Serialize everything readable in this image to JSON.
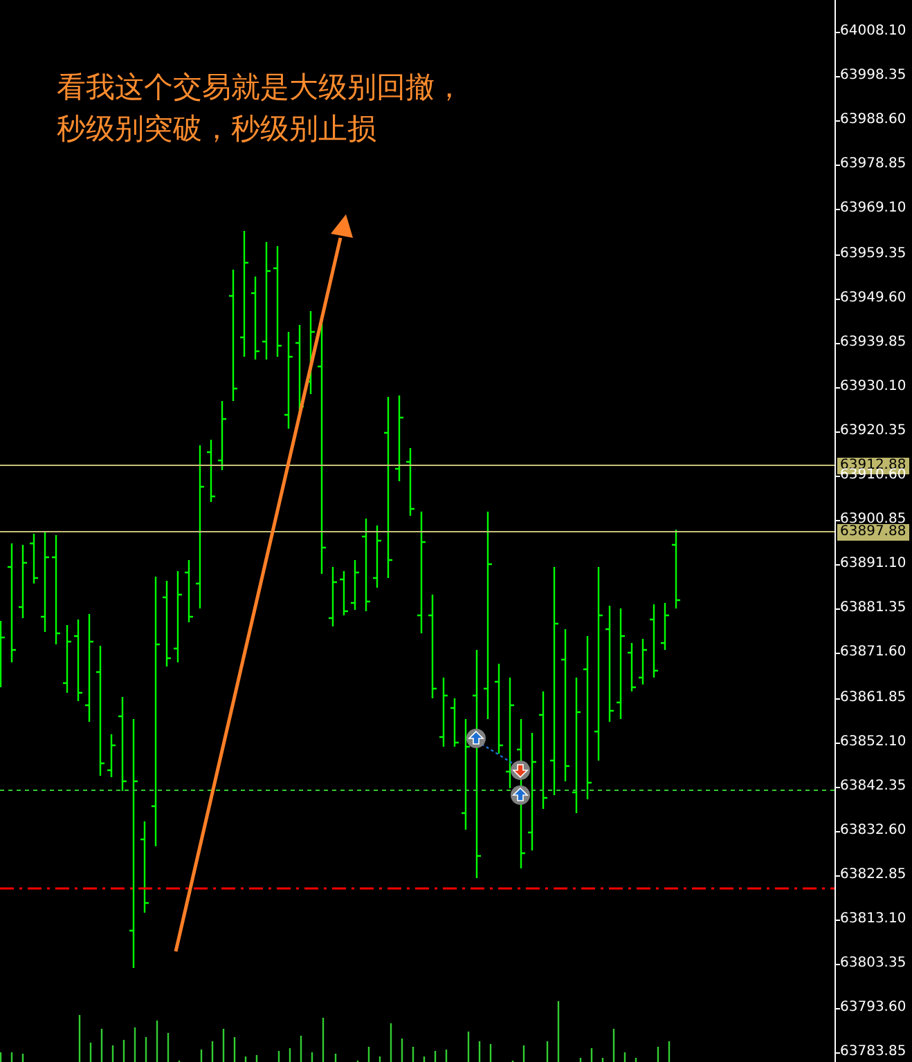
{
  "annotation": {
    "lines": [
      "看我这个交易就是大级别回撤，",
      "秒级别突破，秒级别止损"
    ]
  },
  "price_axis": {
    "labels": [
      "64008.10",
      "63998.35",
      "63988.60",
      "63978.85",
      "63969.10",
      "63959.35",
      "63949.60",
      "63939.85",
      "63930.10",
      "63920.35",
      "63910.60",
      "63900.85",
      "63891.10",
      "63881.35",
      "63871.60",
      "63861.85",
      "63852.10",
      "63842.35",
      "63832.60",
      "63822.85",
      "63813.10",
      "63803.35",
      "63793.60",
      "63783.85"
    ]
  },
  "price_lines": [
    {
      "label": "63912.88"
    },
    {
      "label": "63897.88"
    }
  ],
  "trade_markers": [
    {
      "kind": "buy"
    },
    {
      "kind": "sell"
    },
    {
      "kind": "buy"
    }
  ]
}
